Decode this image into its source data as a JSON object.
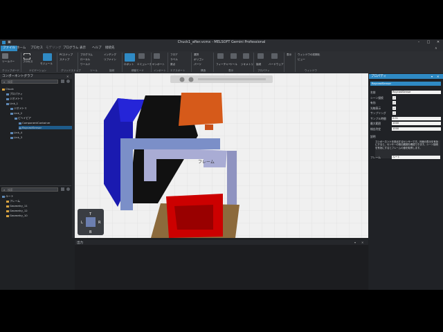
{
  "window": {
    "title": "Chuck1_after.vcmx - MELSOFT Gemini Professional",
    "min": "–",
    "max": "□",
    "close": "✕"
  },
  "menu": [
    "ファイル",
    "ホーム",
    "プロセス",
    "モデリング",
    "プログラム",
    "表示",
    "ヘルプ",
    "接続先"
  ],
  "ribbon": {
    "items": [
      "ツールバー",
      "プロセス",
      "モジュール",
      "PCスナップ",
      "スナップ",
      "プログラム",
      "ローカル",
      "ワールド",
      "インチング",
      "リファイン",
      "ビュー",
      "ロボット",
      "表示モード",
      "エミュレーター",
      "全体表示",
      "選択",
      "ポリゴン",
      "パーツ",
      "インポート",
      "エクスポート",
      "フロア",
      "ラベル",
      "原点",
      "フィーチャー",
      "ツール",
      "ジオメトリ",
      "接続",
      "ハードウェア",
      "ウィンドウの初期化",
      "表示"
    ],
    "groups": [
      "クリップボード",
      "ナビゲーション",
      "グリッドスナップ",
      "ツール",
      "接続",
      "移動モード",
      "インポート",
      "エクスポート",
      "構造",
      "表示",
      "プロパティ",
      "ウィンドウ"
    ]
  },
  "component_graph": {
    "header": "コンポーネントグラフ",
    "search_placeholder": "検索",
    "items": [
      {
        "label": "Chuck",
        "level": 0
      },
      {
        "label": "プロパティ",
        "level": 1
      },
      {
        "label": "ジオメトリ",
        "level": 1
      },
      {
        "label": "Link_1",
        "level": 1
      },
      {
        "label": "ジオメトリ",
        "level": 2
      },
      {
        "label": "Link_2",
        "level": 2
      },
      {
        "label": "ビヘイビア",
        "level": 3
      },
      {
        "label": "ComponentContainer",
        "level": 4
      },
      {
        "label": "RaycastSensor",
        "level": 4
      },
      {
        "label": "Link_4",
        "level": 2
      },
      {
        "label": "Link_3",
        "level": 2
      }
    ]
  },
  "geometry_tree": {
    "search_placeholder": "検索",
    "items": [
      {
        "label": "ルート",
        "level": 0
      },
      {
        "label": "フレーム",
        "level": 1
      },
      {
        "label": "Geometry_11",
        "level": 1
      },
      {
        "label": "Geometry_12",
        "level": 1
      },
      {
        "label": "Geometry_10",
        "level": 1
      }
    ]
  },
  "viewport": {
    "frame_label": "フレーム",
    "cube": {
      "top": "T",
      "left": "L",
      "right": "R",
      "bottom": "B"
    }
  },
  "output": {
    "header": "出力"
  },
  "properties": {
    "header": "プロパティ",
    "component": "RaycastSensor",
    "rows": [
      {
        "label": "名前",
        "value": "RaycastSensor",
        "type": "text"
      },
      {
        "label": "シーン接続",
        "value": "✓",
        "type": "check"
      },
      {
        "label": "有効",
        "value": "✓",
        "type": "check"
      },
      {
        "label": "光線表示",
        "value": "✓",
        "type": "check"
      },
      {
        "label": "サンプリング",
        "value": "✓",
        "type": "check"
      },
      {
        "label": "サンプル時間",
        "value": "0.01",
        "type": "text"
      },
      {
        "label": "最大範囲",
        "value": "1000",
        "type": "text"
      },
      {
        "label": "検出判定",
        "value": "1000",
        "type": "text"
      }
    ],
    "help_title": "説明",
    "help_text": "コンポーネントを検出するセンサーです。光線の表示を有効にすると、センサーの検出範囲を確認できます。シーン接続を有効にするとフレームの値を取得します。",
    "footer_label": "フレーム",
    "footer_value": "ルート"
  },
  "colors": {
    "accent": "#2f8ac4",
    "selection": "#1e5b8a"
  }
}
